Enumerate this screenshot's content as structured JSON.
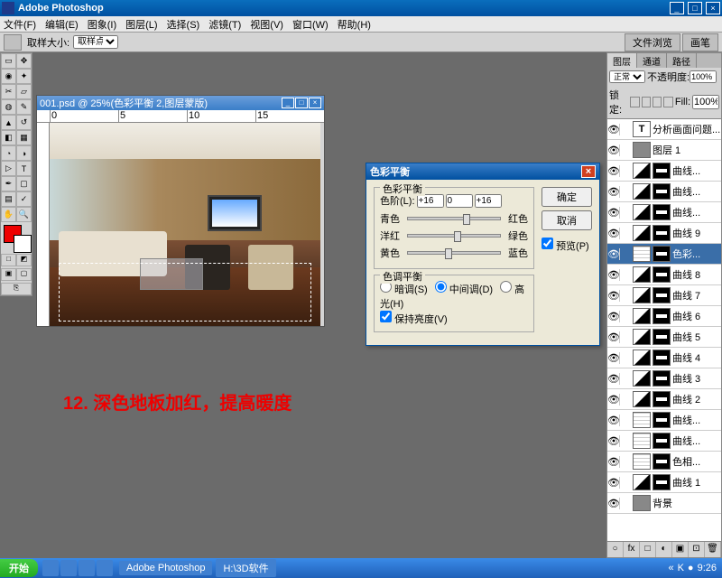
{
  "app": {
    "title": "Adobe Photoshop"
  },
  "menu": [
    "文件(F)",
    "编辑(E)",
    "图象(I)",
    "图层(L)",
    "选择(S)",
    "滤镜(T)",
    "视图(V)",
    "窗口(W)",
    "帮助(H)"
  ],
  "options": {
    "sample_label": "取样大小:",
    "sample_value": "取样点",
    "right_tabs": [
      "文件浏览",
      "画笔"
    ]
  },
  "doc": {
    "title": "001.psd @ 25%(色彩平衡 2,图层蒙版)",
    "ruler_marks": [
      "0",
      "5",
      "10",
      "15"
    ]
  },
  "caption": "12. 深色地板加红，提高暖度",
  "dialog": {
    "title": "色彩平衡",
    "group1": "色彩平衡",
    "levels_label": "色阶(L):",
    "levels": [
      "+16",
      "0",
      "+16"
    ],
    "sliders": [
      {
        "left": "青色",
        "right": "红色",
        "pos": 60
      },
      {
        "left": "洋红",
        "right": "绿色",
        "pos": 50
      },
      {
        "left": "黄色",
        "right": "蓝色",
        "pos": 40
      }
    ],
    "group2": "色调平衡",
    "radios": [
      "暗调(S)",
      "中间调(D)",
      "高光(H)"
    ],
    "radio_selected": 1,
    "preserve": "保持亮度(V)",
    "ok": "确定",
    "cancel": "取消",
    "preview": "预览(P)"
  },
  "layers": {
    "tabs": [
      "图层",
      "通道",
      "路径"
    ],
    "blend": "正常",
    "opacity_label": "不透明度:",
    "opacity": "100%",
    "lock_label": "锁定:",
    "fill_label": "Fill:",
    "fill": "100%",
    "items": [
      {
        "icon": "T",
        "name": "分析画面问题..."
      },
      {
        "icon": "img",
        "name": "图层 1"
      },
      {
        "icon": "curve",
        "mask": true,
        "name": "曲线..."
      },
      {
        "icon": "curve",
        "mask": true,
        "name": "曲线..."
      },
      {
        "icon": "curve",
        "mask": true,
        "name": "曲线..."
      },
      {
        "icon": "curve",
        "mask": true,
        "name": "曲线 9"
      },
      {
        "icon": "grid",
        "mask": true,
        "name": "色彩...",
        "selected": true
      },
      {
        "icon": "curve",
        "mask": true,
        "name": "曲线 8"
      },
      {
        "icon": "curve",
        "mask": true,
        "name": "曲线 7"
      },
      {
        "icon": "curve",
        "mask": true,
        "name": "曲线 6"
      },
      {
        "icon": "curve",
        "mask": true,
        "name": "曲线 5"
      },
      {
        "icon": "curve",
        "mask": true,
        "name": "曲线 4"
      },
      {
        "icon": "curve",
        "mask": true,
        "name": "曲线 3"
      },
      {
        "icon": "curve",
        "mask": true,
        "name": "曲线 2"
      },
      {
        "icon": "grid",
        "mask": true,
        "name": "曲线..."
      },
      {
        "icon": "grid",
        "mask": true,
        "name": "曲线..."
      },
      {
        "icon": "grid",
        "mask": true,
        "name": "色相..."
      },
      {
        "icon": "curve",
        "mask": true,
        "name": "曲线 1"
      },
      {
        "icon": "img",
        "name": "背景"
      }
    ],
    "bottom_icons": [
      "○",
      "fx",
      "□",
      "◐",
      "▣",
      "⊡",
      "🗑"
    ]
  },
  "taskbar": {
    "start": "开始",
    "tasks": [
      "Adobe Photoshop",
      "H:\\3D软件"
    ],
    "time": "9:26"
  }
}
